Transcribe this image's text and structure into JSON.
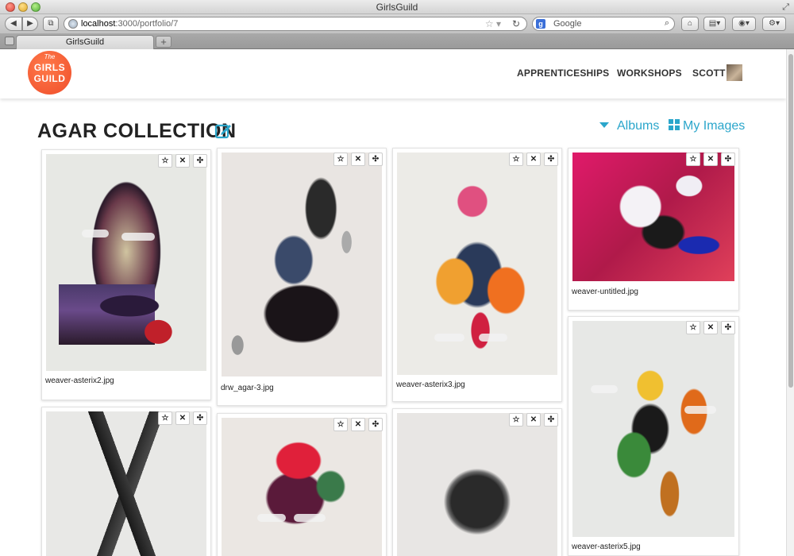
{
  "browser": {
    "window_title": "GirlsGuild",
    "url_host": "localhost",
    "url_rest": ":3000/portfolio/7",
    "search_placeholder": "Google",
    "tab_title": "GirlsGuild",
    "tab_add": "+"
  },
  "site": {
    "logo": {
      "the": "The",
      "girls": "GIRLS",
      "guild": "GUILD"
    },
    "nav": [
      "APPRENTICESHIPS",
      "WORKSHOPS",
      "SCOTT"
    ]
  },
  "page": {
    "title": "AGAR COLLECTION",
    "albums_label": "Albums",
    "my_images_label": "My Images",
    "accent_color": "#2ba6cb"
  },
  "card_actions": {
    "star": "☆",
    "remove": "✕",
    "move": "✣"
  },
  "images": [
    {
      "caption": "weaver-asterix2.jpg"
    },
    {
      "caption": "drw_agar-3.jpg"
    },
    {
      "caption": "weaver-asterix3.jpg"
    },
    {
      "caption": "weaver-untitled.jpg"
    },
    {
      "caption": "weaver-asterix5.jpg"
    },
    {
      "caption": ""
    },
    {
      "caption": ""
    },
    {
      "caption": ""
    }
  ]
}
